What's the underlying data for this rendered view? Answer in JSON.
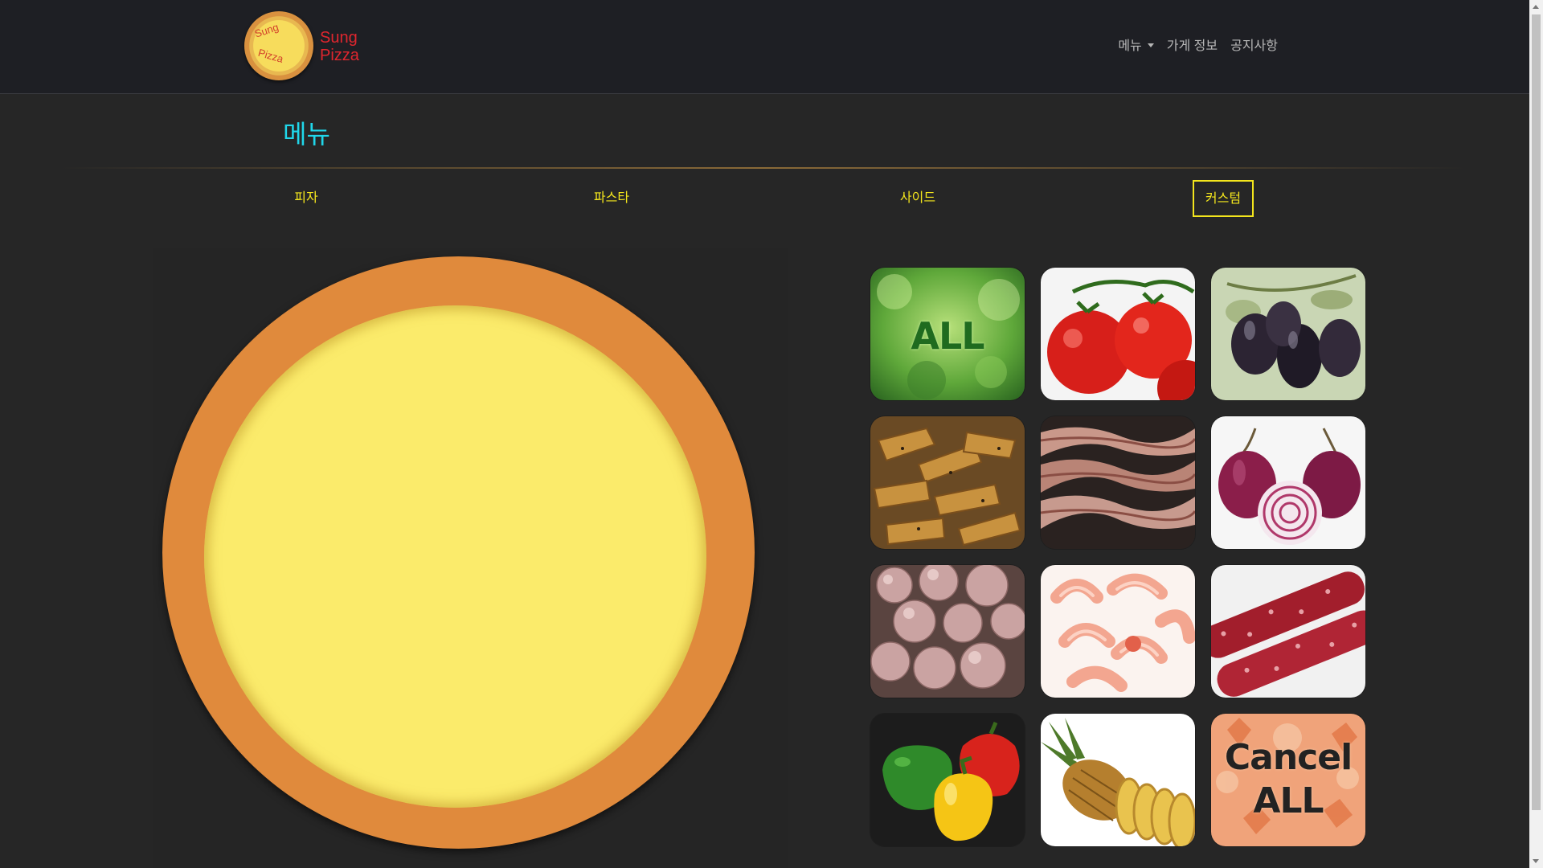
{
  "brand": {
    "logo_text_top": "Sung",
    "logo_text_bottom": "Pizza",
    "name_line1": "Sung",
    "name_line2": "Pizza"
  },
  "nav": {
    "menu": "메뉴",
    "store_info": "가게 정보",
    "notice": "공지사항"
  },
  "page_title": "메뉴",
  "tabs": [
    {
      "label": "피자",
      "active": false
    },
    {
      "label": "파스타",
      "active": false
    },
    {
      "label": "사이드",
      "active": false
    },
    {
      "label": "커스텀",
      "active": true
    }
  ],
  "toppings": [
    {
      "name": "all",
      "label": "ALL"
    },
    {
      "name": "tomato"
    },
    {
      "name": "olive"
    },
    {
      "name": "potato-wedge"
    },
    {
      "name": "bacon"
    },
    {
      "name": "onion"
    },
    {
      "name": "mushroom"
    },
    {
      "name": "shrimp"
    },
    {
      "name": "salami"
    },
    {
      "name": "bell-pepper"
    },
    {
      "name": "pineapple"
    },
    {
      "name": "cancel-all",
      "label_line1": "Cancel",
      "label_line2": "ALL"
    }
  ],
  "colors": {
    "accent_yellow": "#f3e51d",
    "title_cyan": "#20d7ea",
    "crust": "#e08a3c",
    "cheese": "#fbeb6b",
    "brand_red": "#e0262e"
  }
}
